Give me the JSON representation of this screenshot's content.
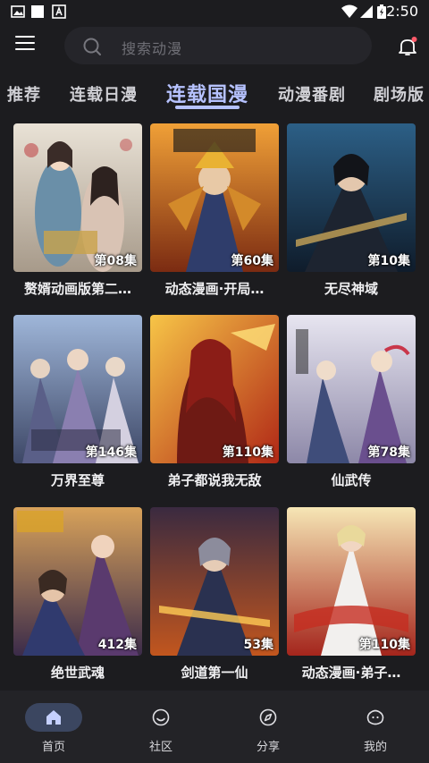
{
  "status_bar": {
    "time": "2:50",
    "icons": [
      "image-icon",
      "square-icon",
      "text-a-icon",
      "wifi-icon",
      "signal-icon",
      "battery-icon"
    ]
  },
  "header": {
    "search_placeholder": "搜索动漫",
    "menu_icon": "menu-icon",
    "search_icon": "search-icon",
    "notification_icon": "bell-icon",
    "notification_dot_color": "#ff5a6a"
  },
  "tabs": [
    {
      "label": "推荐",
      "active": false
    },
    {
      "label": "连载日漫",
      "active": false
    },
    {
      "label": "连载国漫",
      "active": true
    },
    {
      "label": "动漫番剧",
      "active": false
    },
    {
      "label": "剧场版",
      "active": false
    }
  ],
  "accent_color": "#b6c2ff",
  "cards": [
    {
      "title": "赘婿动画版第二…",
      "episode": "第08集"
    },
    {
      "title": "动态漫画·开局…",
      "episode": "第60集"
    },
    {
      "title": "无尽神域",
      "episode": "第10集"
    },
    {
      "title": "万界至尊",
      "episode": "第146集"
    },
    {
      "title": "弟子都说我无敌",
      "episode": "第110集"
    },
    {
      "title": "仙武传",
      "episode": "第78集"
    },
    {
      "title": "绝世武魂",
      "episode": "412集"
    },
    {
      "title": "剑道第一仙",
      "episode": "53集"
    },
    {
      "title": "动态漫画·弟子…",
      "episode": "第110集"
    }
  ],
  "bottom_nav": [
    {
      "label": "首页",
      "icon": "home-icon",
      "active": true
    },
    {
      "label": "社区",
      "icon": "smile-icon",
      "active": false
    },
    {
      "label": "分享",
      "icon": "compass-icon",
      "active": false
    },
    {
      "label": "我的",
      "icon": "face-icon",
      "active": false
    }
  ]
}
